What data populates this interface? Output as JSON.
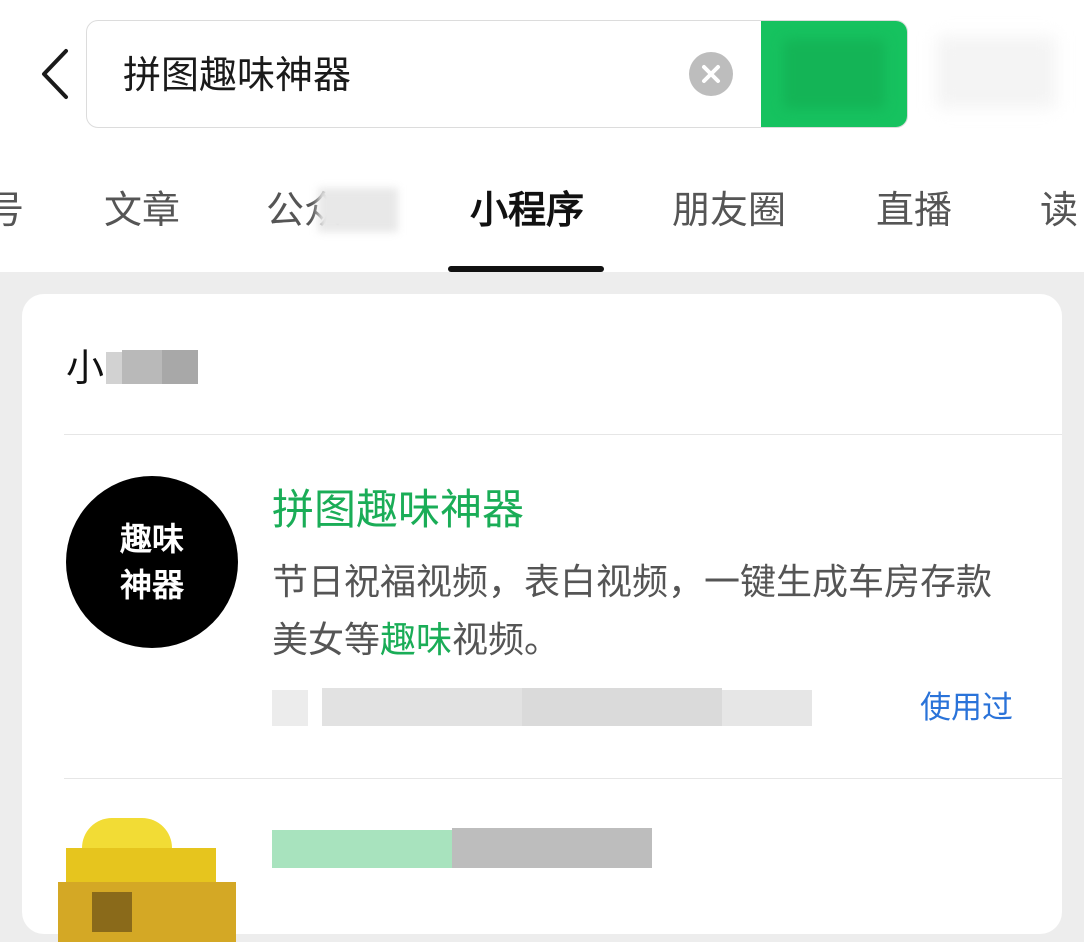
{
  "search": {
    "query": "拼图趣味神器",
    "search_button_label": ""
  },
  "tabs": [
    {
      "label": "号"
    },
    {
      "label": "文章"
    },
    {
      "label": "公众"
    },
    {
      "label": "小程序",
      "active": true
    },
    {
      "label": "朋友圈"
    },
    {
      "label": "直播"
    },
    {
      "label": "读"
    }
  ],
  "section": {
    "title": "小"
  },
  "results": [
    {
      "icon_text": [
        "趣味",
        "神器"
      ],
      "name": "拼图趣味神器",
      "description_before": "节日祝福视频，表白视频，一键生成车房存款美女等",
      "description_highlight": "趣味",
      "description_after": "视频。",
      "status": "使用过"
    }
  ],
  "colors": {
    "accent_green": "#16c25f",
    "highlight_green": "#1aad57",
    "link_blue": "#2a73d9",
    "page_bg": "#ededed"
  },
  "icons": [
    "chevron-left-icon",
    "clear-icon"
  ]
}
